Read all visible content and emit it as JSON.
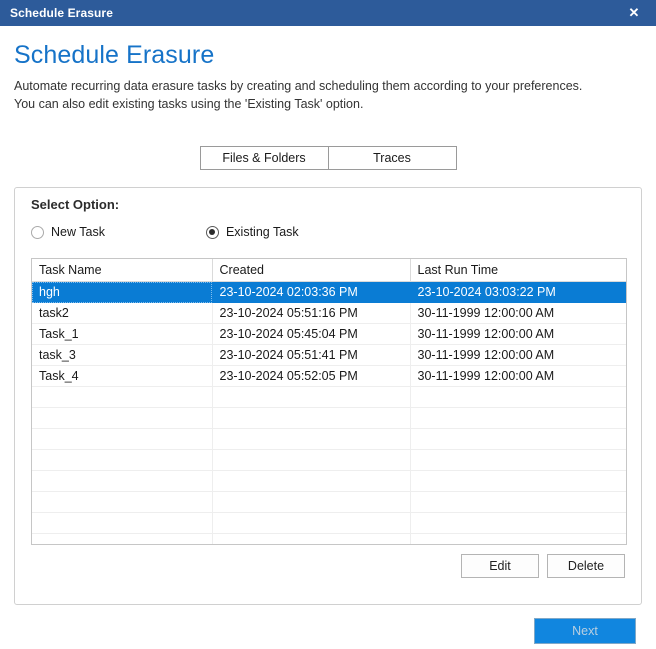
{
  "window": {
    "title": "Schedule Erasure",
    "close_label": "✕"
  },
  "header": {
    "title": "Schedule Erasure",
    "subtitle_line1": "Automate recurring data erasure tasks by creating and scheduling them according to your preferences.",
    "subtitle_line2": "You can also edit existing tasks using the 'Existing Task' option."
  },
  "tabs": [
    {
      "label": "Files & Folders",
      "selected": true
    },
    {
      "label": "Traces",
      "selected": false
    }
  ],
  "group": {
    "title": "Select Option:",
    "radios": [
      {
        "label": "New Task",
        "checked": false
      },
      {
        "label": "Existing Task",
        "checked": true
      }
    ]
  },
  "table": {
    "columns": [
      "Task Name",
      "Created",
      "Last Run Time"
    ],
    "rows": [
      {
        "name": "hgh",
        "created": "23-10-2024 02:03:36 PM",
        "last_run": "23-10-2024 03:03:22 PM",
        "selected": true
      },
      {
        "name": "task2",
        "created": "23-10-2024 05:51:16 PM",
        "last_run": "30-11-1999 12:00:00 AM",
        "selected": false
      },
      {
        "name": "Task_1",
        "created": "23-10-2024 05:45:04 PM",
        "last_run": "30-11-1999 12:00:00 AM",
        "selected": false
      },
      {
        "name": "task_3",
        "created": "23-10-2024 05:51:41 PM",
        "last_run": "30-11-1999 12:00:00 AM",
        "selected": false
      },
      {
        "name": "Task_4",
        "created": "23-10-2024 05:52:05 PM",
        "last_run": "30-11-1999 12:00:00 AM",
        "selected": false
      }
    ],
    "empty_row_count": 8
  },
  "actions": {
    "edit_label": "Edit",
    "delete_label": "Delete"
  },
  "footer": {
    "next_label": "Next"
  },
  "colors": {
    "titlebar": "#2d5b9a",
    "accent_heading": "#1673c8",
    "selection": "#0a7cd4",
    "next_button": "#1186df"
  }
}
